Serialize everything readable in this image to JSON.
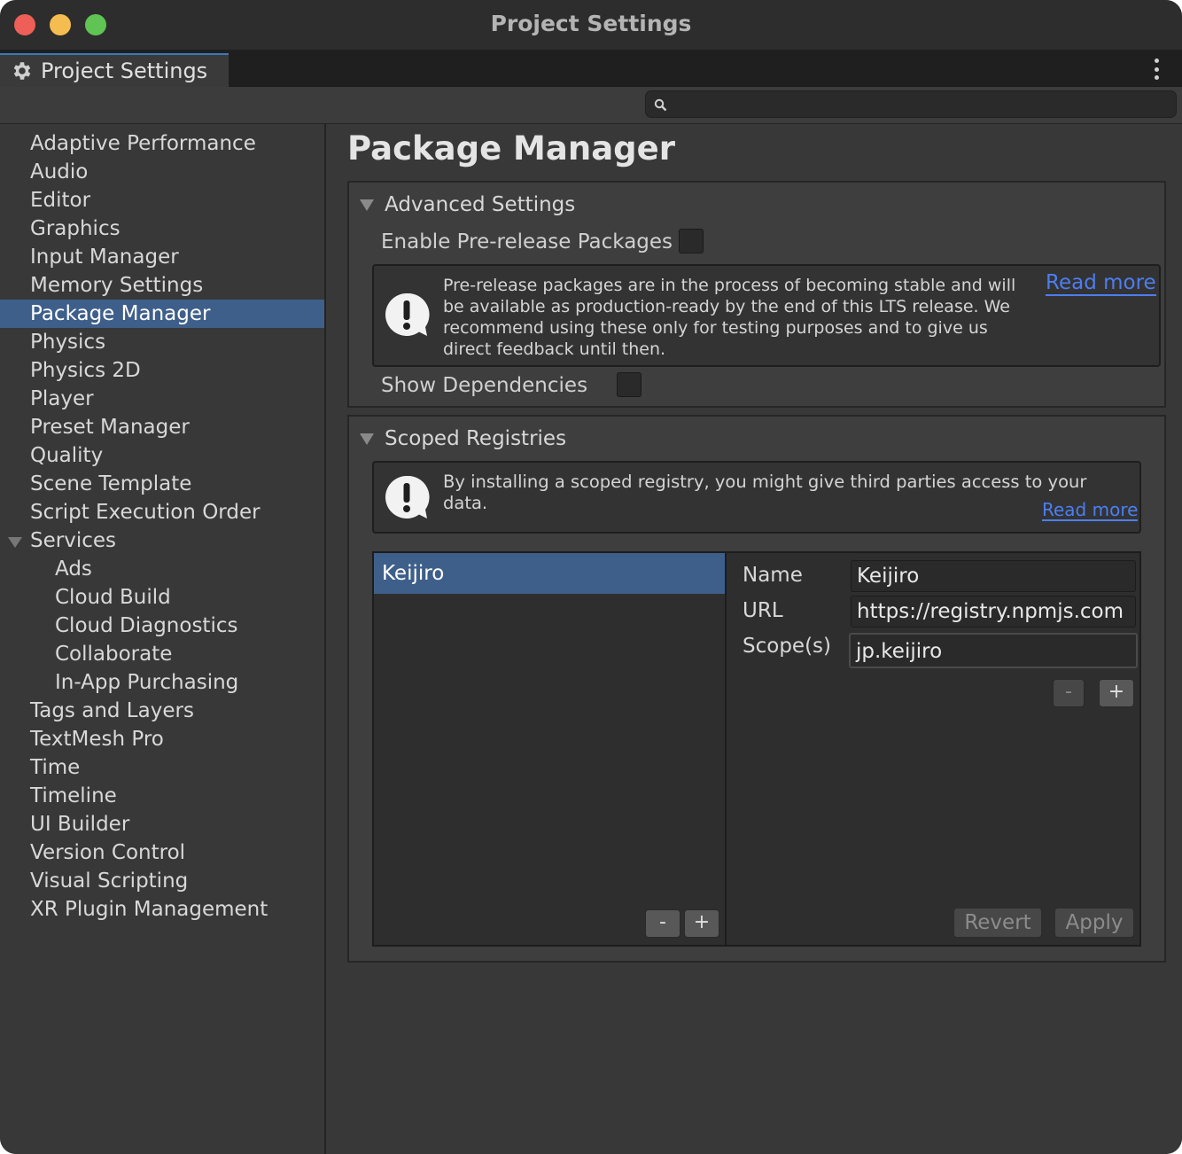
{
  "window": {
    "title": "Project Settings"
  },
  "tab": {
    "label": "Project Settings",
    "icon": "gear-icon"
  },
  "search": {
    "placeholder": "",
    "value": ""
  },
  "sidebar": {
    "items": [
      {
        "label": "Adaptive Performance"
      },
      {
        "label": "Audio"
      },
      {
        "label": "Editor"
      },
      {
        "label": "Graphics"
      },
      {
        "label": "Input Manager"
      },
      {
        "label": "Memory Settings"
      },
      {
        "label": "Package Manager",
        "selected": true
      },
      {
        "label": "Physics"
      },
      {
        "label": "Physics 2D"
      },
      {
        "label": "Player"
      },
      {
        "label": "Preset Manager"
      },
      {
        "label": "Quality"
      },
      {
        "label": "Scene Template"
      },
      {
        "label": "Script Execution Order"
      },
      {
        "label": "Services",
        "expanded": true
      },
      {
        "label": "Ads",
        "child": true
      },
      {
        "label": "Cloud Build",
        "child": true
      },
      {
        "label": "Cloud Diagnostics",
        "child": true
      },
      {
        "label": "Collaborate",
        "child": true
      },
      {
        "label": "In-App Purchasing",
        "child": true
      },
      {
        "label": "Tags and Layers"
      },
      {
        "label": "TextMesh Pro"
      },
      {
        "label": "Time"
      },
      {
        "label": "Timeline"
      },
      {
        "label": "UI Builder"
      },
      {
        "label": "Version Control"
      },
      {
        "label": "Visual Scripting"
      },
      {
        "label": "XR Plugin Management"
      }
    ]
  },
  "main": {
    "title": "Package Manager",
    "advanced": {
      "header": "Advanced Settings",
      "prerelease_label": "Enable Pre-release Packages",
      "prerelease_checked": false,
      "help_text": "Pre-release packages are in the process of becoming stable and will be available as production-ready by the end of this LTS release. We recommend using these only for testing purposes and to give us direct feedback until then.",
      "read_more": "Read more",
      "dependencies_label": "Show Dependencies",
      "dependencies_checked": false
    },
    "registries": {
      "header": "Scoped Registries",
      "help_text": "By installing a scoped registry, you might give third parties access to your data.",
      "read_more": "Read more",
      "list": [
        {
          "name": "Keijiro",
          "selected": true
        }
      ],
      "list_minus": "-",
      "list_plus": "+",
      "detail": {
        "name_label": "Name",
        "name_value": "Keijiro",
        "url_label": "URL",
        "url_value": "https://registry.npmjs.com",
        "scopes_label": "Scope(s)",
        "scopes_value": "jp.keijiro",
        "scope_minus": "-",
        "scope_plus": "+",
        "revert": "Revert",
        "apply": "Apply"
      }
    }
  },
  "colors": {
    "selection": "#3e5f8a",
    "link": "#4c7ef2",
    "traffic_close": "#ee5f57",
    "traffic_min": "#f5bd4f",
    "traffic_max": "#5fc453"
  }
}
